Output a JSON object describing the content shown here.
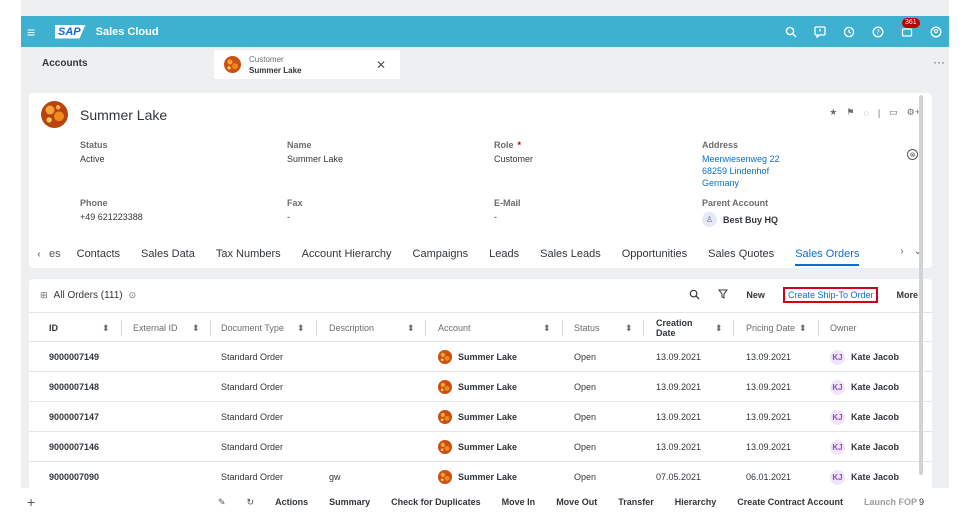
{
  "shell": {
    "logo": "SAP",
    "product": "Sales Cloud",
    "notification_count": "361",
    "icons": [
      "search-icon",
      "feedback-icon",
      "history-icon",
      "help-icon",
      "notification-icon",
      "user-icon"
    ]
  },
  "tabs": {
    "accounts": "Accounts",
    "active_kind": "Customer",
    "active_name": "Summer Lake"
  },
  "header": {
    "name": "Summer Lake",
    "status_label": "Status",
    "status_value": "Active",
    "name_label": "Name",
    "name_value": "Summer Lake",
    "role_label": "Role",
    "role_required": "*",
    "role_value": "Customer",
    "address_label": "Address",
    "address_line1": "Meerwiesenweg 22",
    "address_line2": "68259 Lindenhof",
    "address_line3": "Germany",
    "phone_label": "Phone",
    "phone_value": "+49 621223388",
    "fax_label": "Fax",
    "fax_value": "-",
    "email_label": "E-Mail",
    "email_value": "-",
    "parent_label": "Parent Account",
    "parent_value": "Best Buy HQ"
  },
  "section_tabs": {
    "items": [
      "es",
      "Contacts",
      "Sales Data",
      "Tax Numbers",
      "Account Hierarchy",
      "Campaigns",
      "Leads",
      "Sales Leads",
      "Opportunities",
      "Sales Quotes",
      "Sales Orders"
    ],
    "selected": "Sales Orders"
  },
  "orders": {
    "view_name": "All Orders",
    "count": "(111)",
    "new_label": "New",
    "create_ship_to_label": "Create Ship-To Order",
    "more_label": "More",
    "columns": [
      "ID",
      "External ID",
      "Document Type",
      "Description",
      "Account",
      "Status",
      "Creation Date",
      "Pricing Date",
      "Owner"
    ],
    "rows": [
      {
        "id": "9000007149",
        "ext": "",
        "doctype": "Standard Order",
        "desc": "",
        "account": "Summer Lake",
        "status": "Open",
        "created": "13.09.2021",
        "pricing": "13.09.2021",
        "owner_initials": "KJ",
        "owner": "Kate Jacob"
      },
      {
        "id": "9000007148",
        "ext": "",
        "doctype": "Standard Order",
        "desc": "",
        "account": "Summer Lake",
        "status": "Open",
        "created": "13.09.2021",
        "pricing": "13.09.2021",
        "owner_initials": "KJ",
        "owner": "Kate Jacob"
      },
      {
        "id": "9000007147",
        "ext": "",
        "doctype": "Standard Order",
        "desc": "",
        "account": "Summer Lake",
        "status": "Open",
        "created": "13.09.2021",
        "pricing": "13.09.2021",
        "owner_initials": "KJ",
        "owner": "Kate Jacob"
      },
      {
        "id": "9000007146",
        "ext": "",
        "doctype": "Standard Order",
        "desc": "",
        "account": "Summer Lake",
        "status": "Open",
        "created": "13.09.2021",
        "pricing": "13.09.2021",
        "owner_initials": "KJ",
        "owner": "Kate Jacob"
      },
      {
        "id": "9000007090",
        "ext": "",
        "doctype": "Standard Order",
        "desc": "gw",
        "account": "Summer Lake",
        "status": "Open",
        "created": "07.05.2021",
        "pricing": "06.01.2021",
        "owner_initials": "KJ",
        "owner": "Kate Jacob"
      }
    ]
  },
  "footer": {
    "actions": [
      "Actions",
      "Summary",
      "Check for Duplicates",
      "Move In",
      "Move Out",
      "Transfer",
      "Hierarchy",
      "Create Contract Account"
    ],
    "disabled": "Launch FOP",
    "trailing": "9"
  },
  "colors": {
    "shell": "#3db1cf",
    "accent": "#0a6ed1",
    "highlight": "#d0021b"
  }
}
